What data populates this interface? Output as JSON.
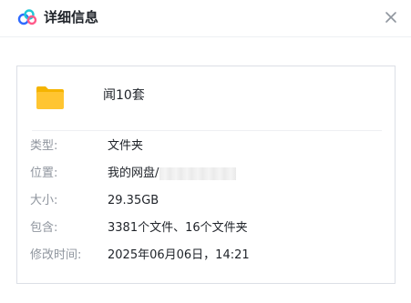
{
  "window": {
    "title": "详细信息",
    "logo_icon": "cloud-logo-icon",
    "close_icon": "close-icon"
  },
  "file": {
    "icon": "folder-icon",
    "icon_color": "#FFC531",
    "name": "闻10套"
  },
  "details": {
    "type_label": "类型:",
    "type_value": "文件夹",
    "location_label": "位置:",
    "location_value": "我的网盘/",
    "size_label": "大小:",
    "size_value": "29.35GB",
    "contains_label": "包含:",
    "contains_value": "3381个文件、16个文件夹",
    "modified_label": "修改时间:",
    "modified_value": "2025年06月06日，14:21"
  },
  "colors": {
    "logo_blue": "#2F6BFF",
    "logo_cyan": "#22C7D6",
    "logo_pink": "#FF5A8A"
  }
}
